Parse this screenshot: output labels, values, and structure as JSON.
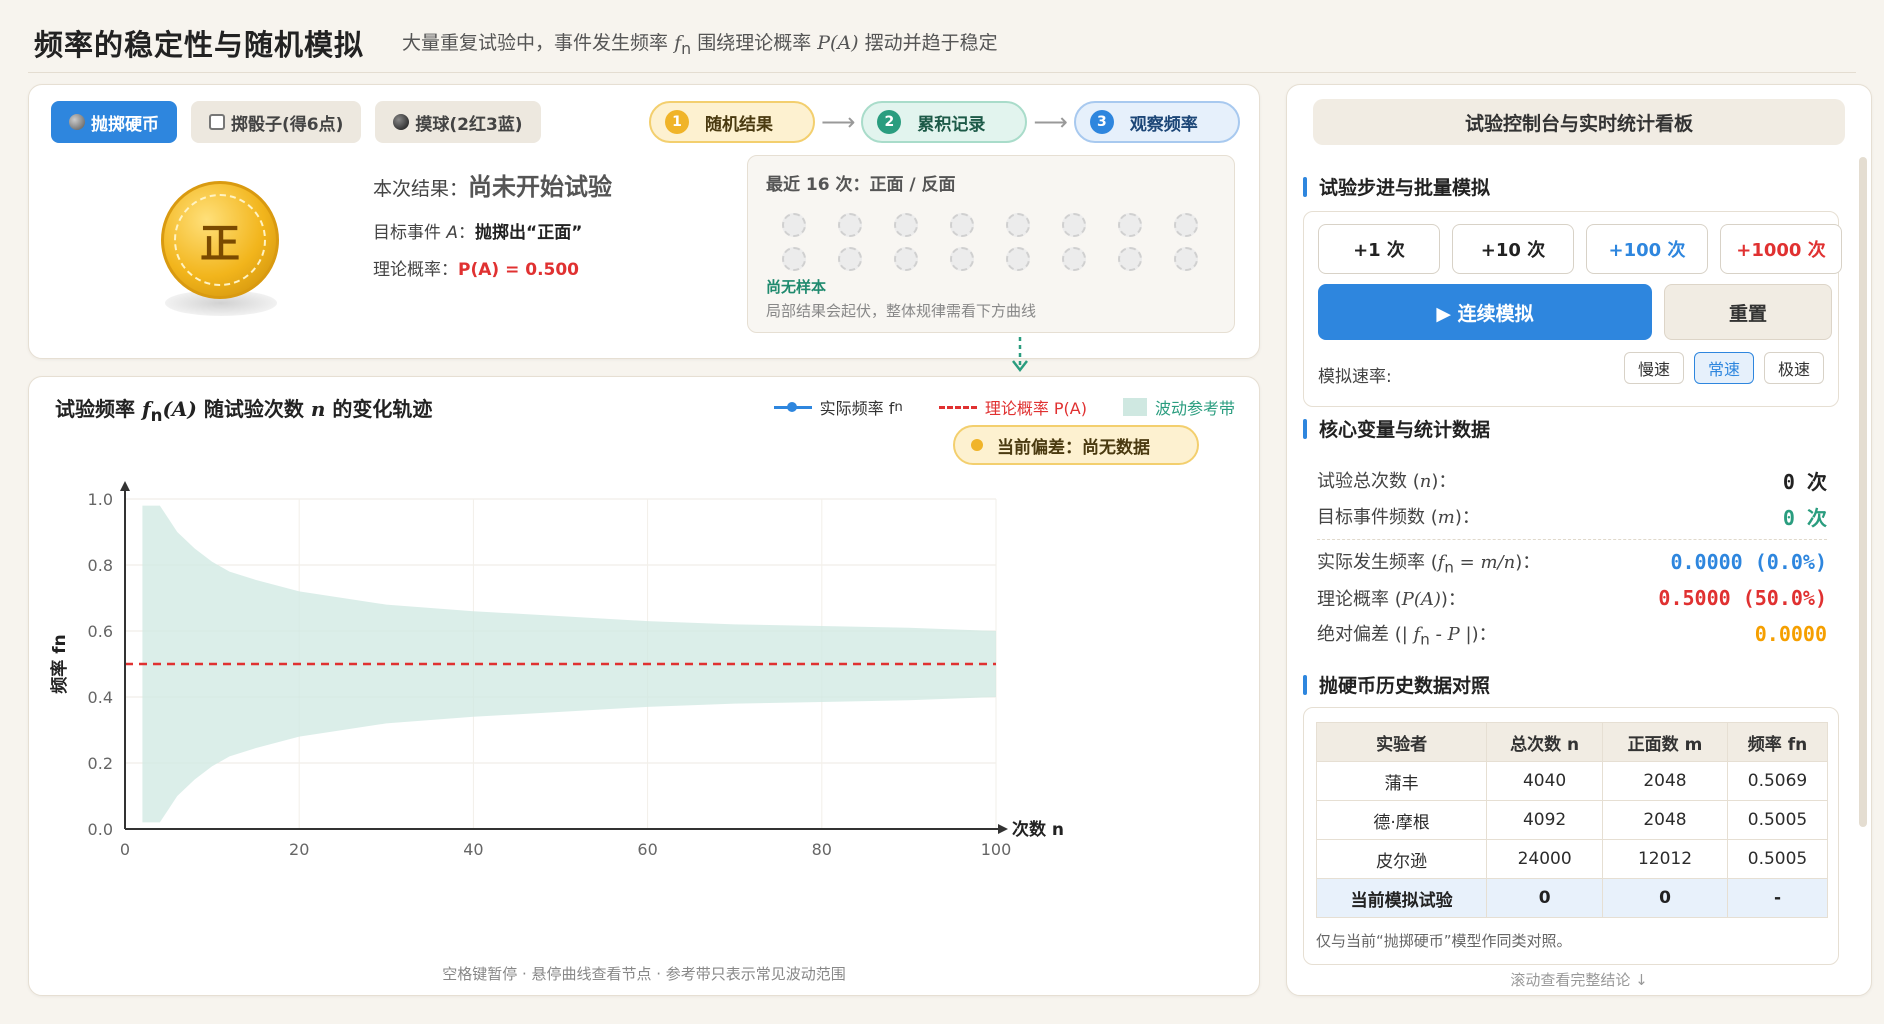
{
  "header": {
    "title": "频率的稳定性与随机模拟",
    "subtitle_pre": "大量重复试验中，事件发生频率 ",
    "subtitle_f": "f",
    "subtitle_n": "n",
    "subtitle_mid": " 围绕理论概率 ",
    "subtitle_pa": "P(A)",
    "subtitle_post": " 摆动并趋于稳定"
  },
  "models": [
    {
      "label": "抛掷硬币",
      "icon": "coin-icon",
      "active": true
    },
    {
      "label": "掷骰子(得6点)",
      "icon": "dice-icon",
      "active": false
    },
    {
      "label": "摸球(2红3蓝)",
      "icon": "ball-icon",
      "active": false
    }
  ],
  "steps": [
    {
      "num": "1",
      "label": "随机结果"
    },
    {
      "num": "2",
      "label": "累积记录"
    },
    {
      "num": "3",
      "label": "观察频率"
    }
  ],
  "coin": {
    "face": "正"
  },
  "result": {
    "label": "本次结果：",
    "value": "尚未开始试验",
    "target_label": "目标事件 ",
    "target_a": "A",
    "target_colon": "：",
    "target_value": "抛掷出“正面”",
    "prob_label": "理论概率：",
    "prob_value": "P(A) = 0.500"
  },
  "recent": {
    "title": "最近 16 次：正面 / 反面",
    "empty": "尚无样本",
    "note": "局部结果会起伏，整体规律需看下方曲线"
  },
  "chart": {
    "title_pre": "试验频率 ",
    "title_f": "f",
    "title_n": "n",
    "title_a": "(A)",
    "title_mid": " 随试验次数 ",
    "title_nn": "n",
    "title_post": " 的变化轨迹",
    "legend_actual": "实际频率 f",
    "legend_actual_sub": "n",
    "legend_theory": "理论概率 P(A)",
    "legend_band": "波动参考带",
    "deviation": "当前偏差：尚无数据",
    "footnote": "空格键暂停 · 悬停曲线查看节点 · 参考带只表示常见波动范围"
  },
  "chart_data": {
    "type": "line",
    "xlabel": "次数 n",
    "ylabel": "频率 fn",
    "xlim": [
      0,
      100
    ],
    "ylim": [
      0.0,
      1.0
    ],
    "x_ticks": [
      "0",
      "20",
      "40",
      "60",
      "80",
      "100"
    ],
    "y_ticks": [
      "0.0",
      "0.2",
      "0.4",
      "0.6",
      "0.8",
      "1.0"
    ],
    "grid": true,
    "theory_value": 0.5,
    "series": [
      {
        "name": "实际频率 fn",
        "x": [],
        "y": []
      },
      {
        "name": "理论概率 P(A)",
        "x": [
          0,
          100
        ],
        "y": [
          0.5,
          0.5
        ]
      }
    ],
    "band": {
      "name": "波动参考带",
      "x": [
        2,
        3,
        4,
        5,
        6,
        8,
        10,
        12,
        15,
        20,
        25,
        30,
        40,
        50,
        60,
        70,
        80,
        90,
        100
      ],
      "upper": [
        0.98,
        0.98,
        0.98,
        0.94,
        0.9,
        0.85,
        0.81,
        0.78,
        0.755,
        0.72,
        0.7,
        0.68,
        0.66,
        0.645,
        0.63,
        0.62,
        0.615,
        0.61,
        0.6
      ],
      "lower": [
        0.02,
        0.02,
        0.02,
        0.06,
        0.1,
        0.15,
        0.19,
        0.22,
        0.245,
        0.28,
        0.3,
        0.32,
        0.34,
        0.355,
        0.37,
        0.38,
        0.385,
        0.39,
        0.4
      ]
    }
  },
  "side": {
    "title": "试验控制台与实时统计看板",
    "sec1": "试验步进与批量模拟",
    "step_buttons": [
      "+1 次",
      "+10 次",
      "+100 次",
      "+1000 次"
    ],
    "run_label": "▶ 连续模拟",
    "reset_label": "重置",
    "speed_label": "模拟速率:",
    "speeds": [
      "慢速",
      "常速",
      "极速"
    ],
    "sec2": "核心变量与统计数据",
    "stats": {
      "total_label": "试验总次数 (",
      "total_var": "n",
      "total_close": ")：",
      "total_value": "0 次",
      "event_label": "目标事件频数 (",
      "event_var": "m",
      "event_close": ")：",
      "event_value": "0 次",
      "freq_label": "实际发生频率 (",
      "freq_var": "f",
      "freq_sub": "n",
      "freq_eq": " = m/n",
      "freq_close": ")：",
      "freq_value": "0.0000 (0.0%)",
      "prob_label": "理论概率 (",
      "prob_var": "P(A)",
      "prob_close": ")：",
      "prob_value": "0.5000 (50.0%)",
      "dev_label": "绝对偏差 (| ",
      "dev_var": "f",
      "dev_sub": "n",
      "dev_mid": " - ",
      "dev_p": "P",
      "dev_close": " |)：",
      "dev_value": "0.0000"
    },
    "sec3": "抛硬币历史数据对照",
    "table_headers": [
      "实验者",
      "总次数 n",
      "正面数 m",
      "频率 fn"
    ],
    "table_rows": [
      [
        "蒲丰",
        "4040",
        "2048",
        "0.5069"
      ],
      [
        "德·摩根",
        "4092",
        "2048",
        "0.5005"
      ],
      [
        "皮尔逊",
        "24000",
        "12012",
        "0.5005"
      ]
    ],
    "current_row": [
      "当前模拟试验",
      "0",
      "0",
      "-"
    ],
    "table_note": "仅与当前“抛掷硬币”模型作同类对照。",
    "scroll_hint": "滚动查看完整结论 ↓"
  },
  "colors": {
    "accent": "#2e86de",
    "theory": "#e03131",
    "band": "#cfe8e1",
    "teal": "#2a9d7f",
    "orange": "#f59f00"
  }
}
